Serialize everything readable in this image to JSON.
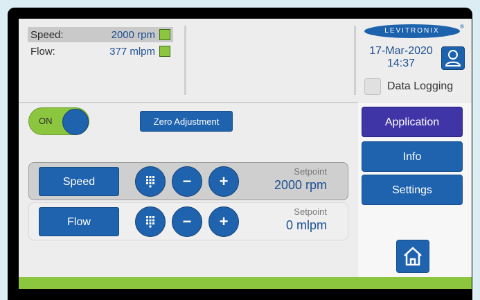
{
  "status": [
    {
      "label": "Speed:",
      "value": "2000 rpm",
      "selected": true
    },
    {
      "label": "Flow:",
      "value": "377 mlpm",
      "selected": false
    }
  ],
  "brand": {
    "logo": "LEVITRONIX",
    "registered": "®"
  },
  "datetime": {
    "date": "17-Mar-2020",
    "time": "14:37"
  },
  "data_logging": {
    "label": "Data Logging",
    "checked": false
  },
  "nav": {
    "application": "Application",
    "info": "Info",
    "settings": "Settings",
    "home_icon": "home-icon"
  },
  "pump_toggle": {
    "label": "ON",
    "state": "on"
  },
  "zero_adjustment": "Zero Adjustment",
  "controls": [
    {
      "mode": "Speed",
      "setpoint_label": "Setpoint",
      "setpoint_value": "2000 rpm",
      "selected": true
    },
    {
      "mode": "Flow",
      "setpoint_label": "Setpoint",
      "setpoint_value": "0 mlpm",
      "selected": false
    }
  ],
  "glyphs": {
    "minus": "−",
    "plus": "+"
  },
  "colors": {
    "accent_blue": "#1f63ae",
    "active_nav": "#3f35a6",
    "status_green": "#8cc63f"
  }
}
